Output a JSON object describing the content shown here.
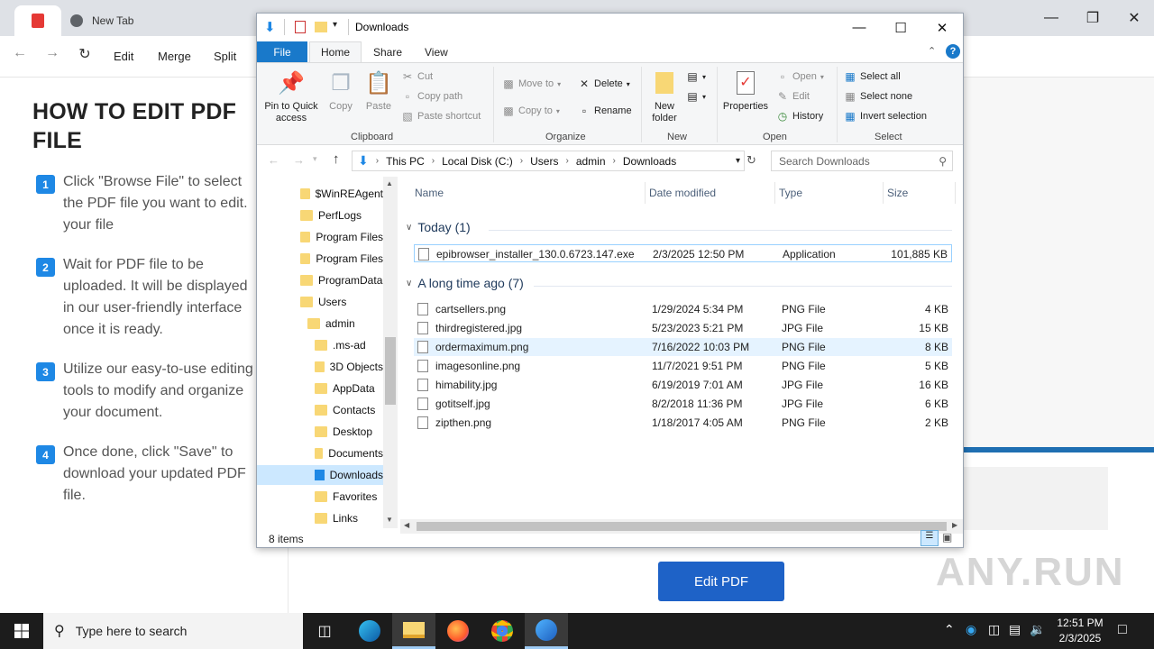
{
  "browser": {
    "tabs": [
      {
        "label": ""
      },
      {
        "label": "New Tab"
      }
    ],
    "menu": [
      "Edit",
      "Merge",
      "Split"
    ]
  },
  "guide": {
    "title": "HOW TO EDIT PDF FILE",
    "steps": [
      {
        "num": "1",
        "text": "Click \"Browse File\" to select the PDF file you want to edit. your file"
      },
      {
        "num": "2",
        "text": "Wait for PDF file to be uploaded. It will be displayed in our user-friendly interface once it is ready."
      },
      {
        "num": "3",
        "text": "Utilize our easy-to-use editing tools to modify and organize your document."
      },
      {
        "num": "4",
        "text": "Once done, click \"Save\" to download your updated PDF file."
      }
    ],
    "edit_button": "Edit PDF",
    "watermark": "ANY.RUN"
  },
  "explorer": {
    "title": "Downloads",
    "ribbon_tabs": [
      "File",
      "Home",
      "Share",
      "View"
    ],
    "ribbon": {
      "clipboard": {
        "label": "Clipboard",
        "pin": "Pin to Quick access",
        "copy": "Copy",
        "paste": "Paste",
        "cut": "Cut",
        "copy_path": "Copy path",
        "paste_shortcut": "Paste shortcut"
      },
      "organize": {
        "label": "Organize",
        "move_to": "Move to",
        "copy_to": "Copy to",
        "delete": "Delete",
        "rename": "Rename"
      },
      "new": {
        "label": "New",
        "new_folder": "New folder"
      },
      "open": {
        "label": "Open",
        "properties": "Properties",
        "open": "Open",
        "edit": "Edit",
        "history": "History"
      },
      "select": {
        "label": "Select",
        "select_all": "Select all",
        "select_none": "Select none",
        "invert": "Invert selection"
      }
    },
    "address": [
      "This PC",
      "Local Disk (C:)",
      "Users",
      "admin",
      "Downloads"
    ],
    "search_placeholder": "Search Downloads",
    "nav": [
      {
        "label": "$WinREAgent",
        "indent": 0
      },
      {
        "label": "PerfLogs",
        "indent": 0
      },
      {
        "label": "Program Files",
        "indent": 0
      },
      {
        "label": "Program Files",
        "indent": 0
      },
      {
        "label": "ProgramData",
        "indent": 0
      },
      {
        "label": "Users",
        "indent": 0
      },
      {
        "label": "admin",
        "indent": 1
      },
      {
        "label": ".ms-ad",
        "indent": 2
      },
      {
        "label": "3D Objects",
        "indent": 2
      },
      {
        "label": "AppData",
        "indent": 2
      },
      {
        "label": "Contacts",
        "indent": 2
      },
      {
        "label": "Desktop",
        "indent": 2
      },
      {
        "label": "Documents",
        "indent": 2
      },
      {
        "label": "Downloads",
        "indent": 2,
        "selected": true
      },
      {
        "label": "Favorites",
        "indent": 2
      },
      {
        "label": "Links",
        "indent": 2
      }
    ],
    "columns": [
      "Name",
      "Date modified",
      "Type",
      "Size"
    ],
    "groups": [
      {
        "label": "Today (1)",
        "files": [
          {
            "name": "epibrowser_installer_130.0.6723.147.exe",
            "date": "2/3/2025 12:50 PM",
            "type": "Application",
            "size": "101,885 KB"
          }
        ]
      },
      {
        "label": "A long time ago (7)",
        "files": [
          {
            "name": "cartsellers.png",
            "date": "1/29/2024 5:34 PM",
            "type": "PNG File",
            "size": "4 KB"
          },
          {
            "name": "thirdregistered.jpg",
            "date": "5/23/2023 5:21 PM",
            "type": "JPG File",
            "size": "15 KB"
          },
          {
            "name": "ordermaximum.png",
            "date": "7/16/2022 10:03 PM",
            "type": "PNG File",
            "size": "8 KB"
          },
          {
            "name": "imagesonline.png",
            "date": "11/7/2021 9:51 PM",
            "type": "PNG File",
            "size": "5 KB"
          },
          {
            "name": "himability.jpg",
            "date": "6/19/2019 7:01 AM",
            "type": "JPG File",
            "size": "16 KB"
          },
          {
            "name": "gotitself.jpg",
            "date": "8/2/2018 11:36 PM",
            "type": "JPG File",
            "size": "6 KB"
          },
          {
            "name": "zipthen.png",
            "date": "1/18/2017 4:05 AM",
            "type": "PNG File",
            "size": "2 KB"
          }
        ]
      }
    ],
    "status": "8 items"
  },
  "taskbar": {
    "search_placeholder": "Type here to search",
    "time": "12:51 PM",
    "date": "2/3/2025"
  }
}
